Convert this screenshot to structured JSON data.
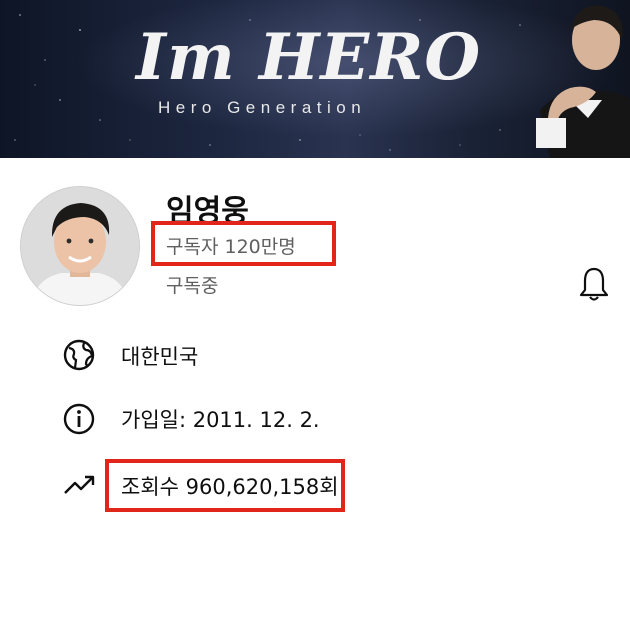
{
  "banner": {
    "title": "Im HERO",
    "subtitle": "Hero Generation"
  },
  "channel": {
    "name": "임영웅",
    "subscribers": "구독자 120만명",
    "subscribed_label": "구독중"
  },
  "about": {
    "country": "대한민국",
    "joined": "가입일: 2011. 12. 2.",
    "views": "조회수 960,620,158회"
  },
  "icons": {
    "bell": "bell-icon",
    "country": "globe-icon",
    "joined": "info-icon",
    "views": "trending-icon"
  },
  "colors": {
    "highlight": "#e1251b",
    "secondary_text": "#606060",
    "primary_text": "#0f0f0f"
  }
}
